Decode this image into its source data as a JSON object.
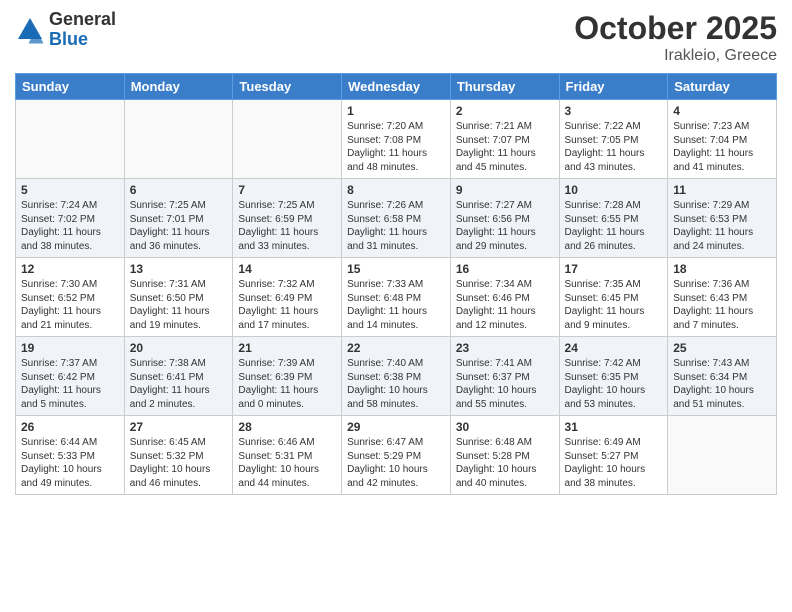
{
  "header": {
    "logo_general": "General",
    "logo_blue": "Blue",
    "month_title": "October 2025",
    "location": "Irakleio, Greece"
  },
  "weekdays": [
    "Sunday",
    "Monday",
    "Tuesday",
    "Wednesday",
    "Thursday",
    "Friday",
    "Saturday"
  ],
  "weeks": [
    [
      {
        "day": "",
        "info": ""
      },
      {
        "day": "",
        "info": ""
      },
      {
        "day": "",
        "info": ""
      },
      {
        "day": "1",
        "info": "Sunrise: 7:20 AM\nSunset: 7:08 PM\nDaylight: 11 hours and 48 minutes."
      },
      {
        "day": "2",
        "info": "Sunrise: 7:21 AM\nSunset: 7:07 PM\nDaylight: 11 hours and 45 minutes."
      },
      {
        "day": "3",
        "info": "Sunrise: 7:22 AM\nSunset: 7:05 PM\nDaylight: 11 hours and 43 minutes."
      },
      {
        "day": "4",
        "info": "Sunrise: 7:23 AM\nSunset: 7:04 PM\nDaylight: 11 hours and 41 minutes."
      }
    ],
    [
      {
        "day": "5",
        "info": "Sunrise: 7:24 AM\nSunset: 7:02 PM\nDaylight: 11 hours and 38 minutes."
      },
      {
        "day": "6",
        "info": "Sunrise: 7:25 AM\nSunset: 7:01 PM\nDaylight: 11 hours and 36 minutes."
      },
      {
        "day": "7",
        "info": "Sunrise: 7:25 AM\nSunset: 6:59 PM\nDaylight: 11 hours and 33 minutes."
      },
      {
        "day": "8",
        "info": "Sunrise: 7:26 AM\nSunset: 6:58 PM\nDaylight: 11 hours and 31 minutes."
      },
      {
        "day": "9",
        "info": "Sunrise: 7:27 AM\nSunset: 6:56 PM\nDaylight: 11 hours and 29 minutes."
      },
      {
        "day": "10",
        "info": "Sunrise: 7:28 AM\nSunset: 6:55 PM\nDaylight: 11 hours and 26 minutes."
      },
      {
        "day": "11",
        "info": "Sunrise: 7:29 AM\nSunset: 6:53 PM\nDaylight: 11 hours and 24 minutes."
      }
    ],
    [
      {
        "day": "12",
        "info": "Sunrise: 7:30 AM\nSunset: 6:52 PM\nDaylight: 11 hours and 21 minutes."
      },
      {
        "day": "13",
        "info": "Sunrise: 7:31 AM\nSunset: 6:50 PM\nDaylight: 11 hours and 19 minutes."
      },
      {
        "day": "14",
        "info": "Sunrise: 7:32 AM\nSunset: 6:49 PM\nDaylight: 11 hours and 17 minutes."
      },
      {
        "day": "15",
        "info": "Sunrise: 7:33 AM\nSunset: 6:48 PM\nDaylight: 11 hours and 14 minutes."
      },
      {
        "day": "16",
        "info": "Sunrise: 7:34 AM\nSunset: 6:46 PM\nDaylight: 11 hours and 12 minutes."
      },
      {
        "day": "17",
        "info": "Sunrise: 7:35 AM\nSunset: 6:45 PM\nDaylight: 11 hours and 9 minutes."
      },
      {
        "day": "18",
        "info": "Sunrise: 7:36 AM\nSunset: 6:43 PM\nDaylight: 11 hours and 7 minutes."
      }
    ],
    [
      {
        "day": "19",
        "info": "Sunrise: 7:37 AM\nSunset: 6:42 PM\nDaylight: 11 hours and 5 minutes."
      },
      {
        "day": "20",
        "info": "Sunrise: 7:38 AM\nSunset: 6:41 PM\nDaylight: 11 hours and 2 minutes."
      },
      {
        "day": "21",
        "info": "Sunrise: 7:39 AM\nSunset: 6:39 PM\nDaylight: 11 hours and 0 minutes."
      },
      {
        "day": "22",
        "info": "Sunrise: 7:40 AM\nSunset: 6:38 PM\nDaylight: 10 hours and 58 minutes."
      },
      {
        "day": "23",
        "info": "Sunrise: 7:41 AM\nSunset: 6:37 PM\nDaylight: 10 hours and 55 minutes."
      },
      {
        "day": "24",
        "info": "Sunrise: 7:42 AM\nSunset: 6:35 PM\nDaylight: 10 hours and 53 minutes."
      },
      {
        "day": "25",
        "info": "Sunrise: 7:43 AM\nSunset: 6:34 PM\nDaylight: 10 hours and 51 minutes."
      }
    ],
    [
      {
        "day": "26",
        "info": "Sunrise: 6:44 AM\nSunset: 5:33 PM\nDaylight: 10 hours and 49 minutes."
      },
      {
        "day": "27",
        "info": "Sunrise: 6:45 AM\nSunset: 5:32 PM\nDaylight: 10 hours and 46 minutes."
      },
      {
        "day": "28",
        "info": "Sunrise: 6:46 AM\nSunset: 5:31 PM\nDaylight: 10 hours and 44 minutes."
      },
      {
        "day": "29",
        "info": "Sunrise: 6:47 AM\nSunset: 5:29 PM\nDaylight: 10 hours and 42 minutes."
      },
      {
        "day": "30",
        "info": "Sunrise: 6:48 AM\nSunset: 5:28 PM\nDaylight: 10 hours and 40 minutes."
      },
      {
        "day": "31",
        "info": "Sunrise: 6:49 AM\nSunset: 5:27 PM\nDaylight: 10 hours and 38 minutes."
      },
      {
        "day": "",
        "info": ""
      }
    ]
  ]
}
